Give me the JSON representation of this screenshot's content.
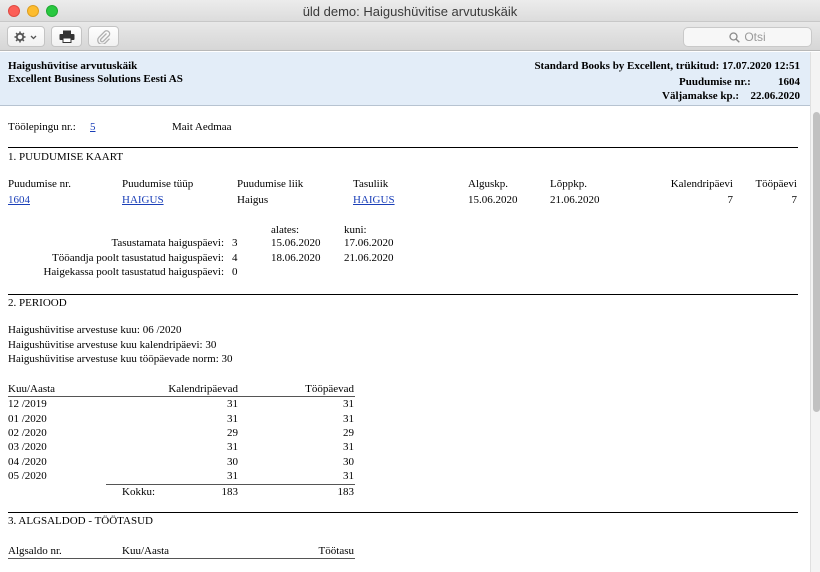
{
  "window": {
    "title": "üld demo: Haigushüvitise arvutuskäik"
  },
  "toolbar": {
    "search_placeholder": "Otsi"
  },
  "report": {
    "title": "Haigushüvitise arvutuskäik",
    "company": "Excellent Business Solutions Eesti AS",
    "printed": "Standard Books by Excellent, trükitud: 17.07.2020 12:51",
    "absence_nr_label": "Puudumise nr.:",
    "absence_nr_value": "1604",
    "payout_label": "Väljamakse kp.:",
    "payout_value": "22.06.2020",
    "contract_label": "Töölepingu nr.:",
    "contract_value": "5",
    "employee": "Mait Aedmaa"
  },
  "section1": {
    "heading": "1. PUUDUMISE KAART",
    "columns": [
      "Puudumise nr.",
      "Puudumise tüüp",
      "Puudumise liik",
      "Tasuliik",
      "Alguskp.",
      "Lõppkp.",
      "Kalendripäevi",
      "Tööpäevi"
    ],
    "row": [
      "1604",
      "HAIGUS",
      "Haigus",
      "HAIGUS",
      "15.06.2020",
      "21.06.2020",
      "7",
      "7"
    ],
    "from_label": "alates:",
    "to_label": "kuni:",
    "details": [
      {
        "label": "Tasustamata haiguspäevi:",
        "value": "3",
        "from": "15.06.2020",
        "to": "17.06.2020"
      },
      {
        "label": "Tööandja poolt tasustatud haiguspäevi:",
        "value": "4",
        "from": "18.06.2020",
        "to": "21.06.2020"
      },
      {
        "label": "Haigekassa poolt tasustatud haiguspäevi:",
        "value": "0",
        "from": "",
        "to": ""
      }
    ]
  },
  "section2": {
    "heading": "2. PERIOOD",
    "lines": [
      "Haigushüvitise arvestuse kuu:  06 /2020",
      "Haigushüvitise arvestuse kuu kalendripäevi:  30",
      "Haigushüvitise arvestuse kuu tööpäevade norm:  30"
    ],
    "columns": [
      "Kuu/Aasta",
      "Kalendripäevad",
      "Tööpäevad"
    ],
    "rows": [
      [
        "12 /2019",
        "31",
        "31"
      ],
      [
        "01 /2020",
        "31",
        "31"
      ],
      [
        "02 /2020",
        "29",
        "29"
      ],
      [
        "03 /2020",
        "31",
        "31"
      ],
      [
        "04 /2020",
        "30",
        "30"
      ],
      [
        "05 /2020",
        "31",
        "31"
      ]
    ],
    "total_label": "Kokku:",
    "total_calendar": "183",
    "total_work": "183"
  },
  "section3": {
    "heading": "3. ALGSALDOD - TÖÖTASUD",
    "columns": [
      "Algsaldo nr.",
      "Kuu/Aasta",
      "Töötasu"
    ]
  },
  "colors": {
    "header_band": "#e3edf8",
    "link": "#1a3fb8"
  }
}
